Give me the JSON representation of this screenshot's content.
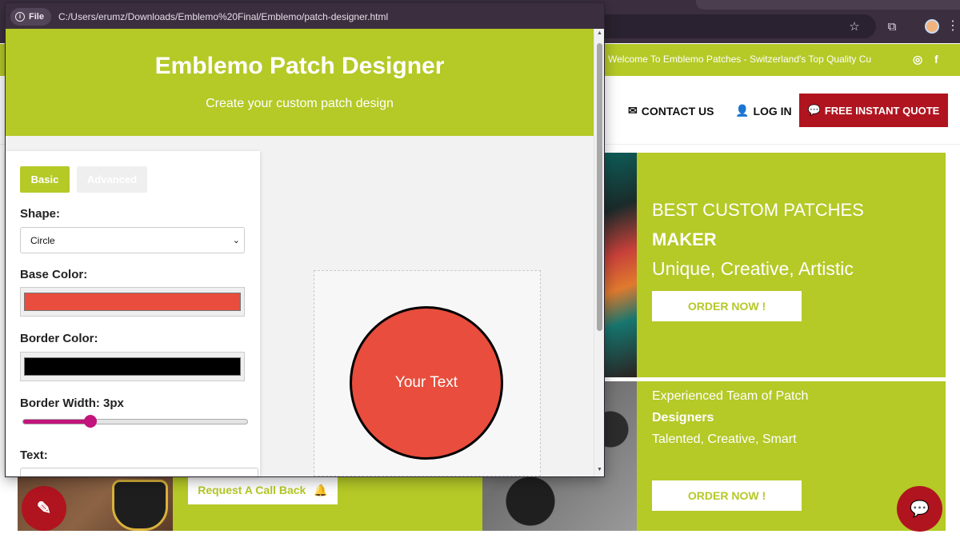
{
  "browser": {
    "bookmark_icon": "star-icon",
    "extensions_icon": "puzzle-icon",
    "menu_icon": "kebab-icon"
  },
  "website": {
    "announcement": "Welcome To Emblemo Patches - Switzerland's Top Quality Cu",
    "social": [
      "instagram-icon",
      "facebook-icon"
    ],
    "nav": {
      "contact": "CONTACT US",
      "login": "LOG IN",
      "quote": "FREE INSTANT QUOTE"
    },
    "hero1": {
      "line1": "BEST CUSTOM PATCHES",
      "line2": "MAKER",
      "line3": "Unique, Creative, Artistic",
      "button": "ORDER NOW !"
    },
    "hero2": {
      "line1": "Experienced Team of Patch",
      "line2": "Designers",
      "line3": "Talented, Creative, Smart",
      "button": "ORDER NOW !"
    },
    "callback_button": "Request A Call Back"
  },
  "popup": {
    "file_label": "File",
    "url": "C:/Users/erumz/Downloads/Emblemo%20Final/Emblemo/patch-designer.html",
    "designer": {
      "title": "Emblemo Patch Designer",
      "subtitle": "Create your custom patch design",
      "tabs": {
        "basic": "Basic",
        "advanced": "Advanced"
      },
      "shape_label": "Shape:",
      "shape_value": "Circle",
      "base_color_label": "Base Color:",
      "base_color": "#e84d3d",
      "border_color_label": "Border Color:",
      "border_color": "#000000",
      "border_width_label": "Border Width: 3px",
      "border_width_fraction": 0.3,
      "text_label": "Text:",
      "patch_text": "Your Text"
    }
  },
  "colors": {
    "brand_green": "#b5c927",
    "brand_red": "#b0141f",
    "slider_accent": "#c2147a"
  }
}
